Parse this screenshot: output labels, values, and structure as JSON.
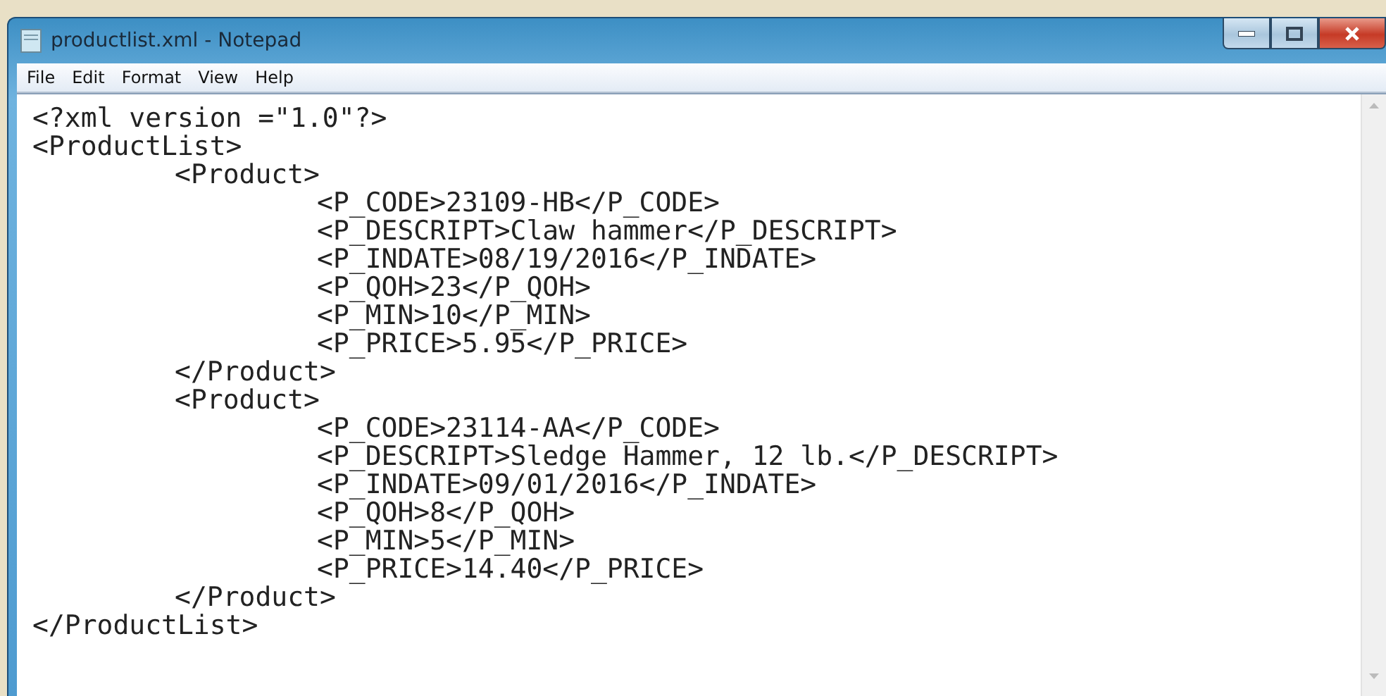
{
  "window": {
    "title": "productlist.xml - Notepad"
  },
  "menu": [
    "File",
    "Edit",
    "Format",
    "View",
    "Help"
  ],
  "document": {
    "lines": [
      {
        "text": "<?xml version =\"1.0\"?>"
      },
      {
        "text": "<ProductList>",
        "close": "</ProductList>",
        "children": [
          {
            "text": "<Product>",
            "close": "</Product>",
            "children": [
              {
                "text": "<P_CODE>23109-HB</P_CODE>"
              },
              {
                "text": "<P_DESCRIPT>Claw hammer</P_DESCRIPT>"
              },
              {
                "text": "<P_INDATE>08/19/2016</P_INDATE>"
              },
              {
                "text": "<P_QOH>23</P_QOH>"
              },
              {
                "text": "<P_MIN>10</P_MIN>"
              },
              {
                "text": "<P_PRICE>5.95</P_PRICE>"
              }
            ]
          },
          {
            "text": "<Product>",
            "close": "</Product>",
            "children": [
              {
                "text": "<P_CODE>23114-AA</P_CODE>"
              },
              {
                "text": "<P_DESCRIPT>Sledge Hammer, 12 lb.</P_DESCRIPT>"
              },
              {
                "text": "<P_INDATE>09/01/2016</P_INDATE>"
              },
              {
                "text": "<P_QOH>8</P_QOH>"
              },
              {
                "text": "<P_MIN>5</P_MIN>"
              },
              {
                "text": "<P_PRICE>14.40</P_PRICE>"
              }
            ]
          }
        ]
      }
    ]
  }
}
